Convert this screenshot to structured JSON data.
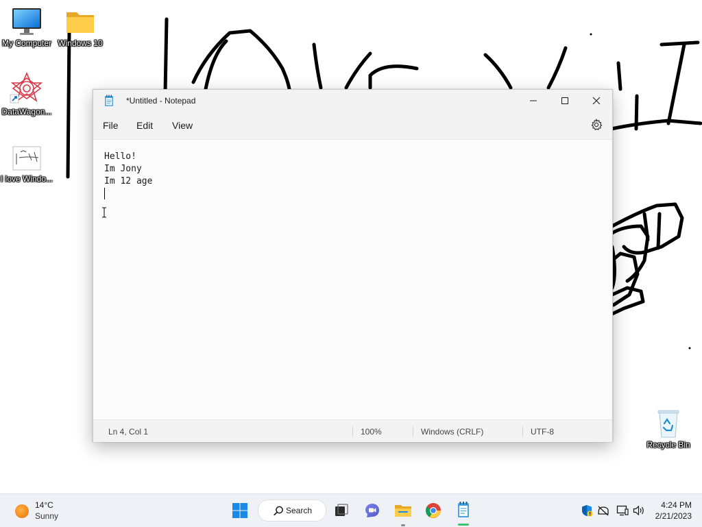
{
  "desktop": {
    "icons": [
      {
        "label": "My Computer",
        "icon": "monitor-icon"
      },
      {
        "label": "Windows 10",
        "icon": "folder-icon"
      },
      {
        "label": "DataWagon...",
        "icon": "mandala-shortcut-icon"
      },
      {
        "label": "I love Windo...",
        "icon": "image-file-icon"
      },
      {
        "label": "Recycle Bin",
        "icon": "recycle-bin-icon"
      }
    ]
  },
  "notepad": {
    "title": "*Untitled - Notepad",
    "menu": [
      "File",
      "Edit",
      "View"
    ],
    "lines": [
      "Hello!",
      "Im Jony",
      "Im 12 age"
    ],
    "status": {
      "position": "Ln 4, Col 1",
      "zoom": "100%",
      "line_ending": "Windows (CRLF)",
      "encoding": "UTF-8"
    }
  },
  "taskbar": {
    "weather": {
      "temp": "14°C",
      "condition": "Sunny"
    },
    "search_label": "Search",
    "clock": {
      "time": "4:24 PM",
      "date": "2/21/2023"
    },
    "apps": [
      "start-icon",
      "search-icon",
      "task-view-icon",
      "chat-icon",
      "file-explorer-icon",
      "chrome-icon",
      "notepad-icon"
    ],
    "tray": [
      "defender-shield-icon",
      "network-icon",
      "display-icon",
      "volume-icon"
    ]
  },
  "colors": {
    "accent": "#0067c0",
    "desktop_bg": "#ffffff",
    "active_indicator": "#3cc36c"
  }
}
